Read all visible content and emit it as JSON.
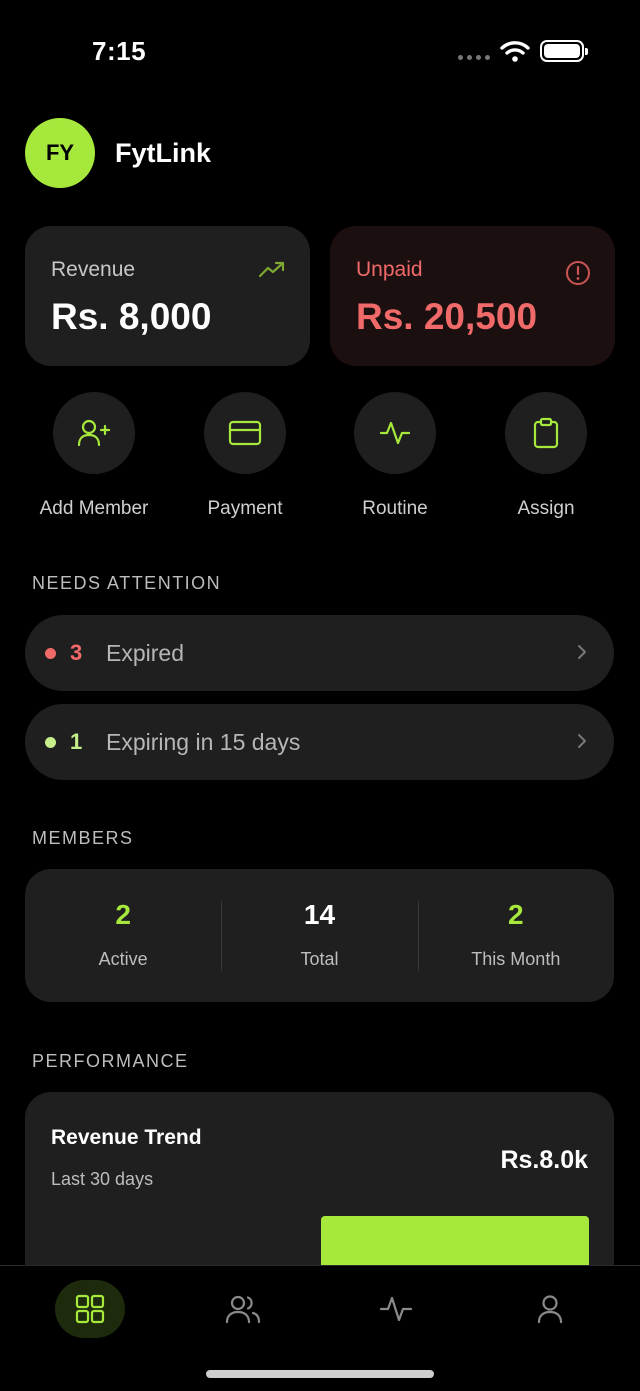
{
  "status_bar": {
    "time": "7:15"
  },
  "header": {
    "avatar_initials": "FY",
    "brand": "FytLink"
  },
  "stats": {
    "revenue": {
      "label": "Revenue",
      "value": "Rs. 8,000"
    },
    "unpaid": {
      "label": "Unpaid",
      "value": "Rs. 20,500"
    }
  },
  "actions": [
    {
      "label": "Add Member",
      "icon": "add-user-icon"
    },
    {
      "label": "Payment",
      "icon": "card-icon"
    },
    {
      "label": "Routine",
      "icon": "activity-icon"
    },
    {
      "label": "Assign",
      "icon": "clipboard-icon"
    }
  ],
  "sections": {
    "attention": "NEEDS ATTENTION",
    "members": "MEMBERS",
    "performance": "PERFORMANCE"
  },
  "attention": [
    {
      "count": "3",
      "text": "Expired",
      "color": "#f06a6a"
    },
    {
      "count": "1",
      "text": "Expiring in 15 days",
      "color": "#c6ef8a"
    }
  ],
  "members": [
    {
      "value": "2",
      "label": "Active",
      "color": "#a6e83c"
    },
    {
      "value": "14",
      "label": "Total",
      "color": "#ffffff"
    },
    {
      "value": "2",
      "label": "This Month",
      "color": "#a6e83c"
    }
  ],
  "performance": {
    "title": "Revenue Trend",
    "subtitle": "Last 30 days",
    "value": "Rs.8.0k"
  },
  "tabs": [
    {
      "icon": "grid-icon",
      "active": true
    },
    {
      "icon": "users-icon",
      "active": false
    },
    {
      "icon": "activity-icon",
      "active": false
    },
    {
      "icon": "profile-icon",
      "active": false
    }
  ],
  "colors": {
    "accent": "#a6e83c",
    "danger": "#f06a6a",
    "card": "#1f1f1f"
  }
}
